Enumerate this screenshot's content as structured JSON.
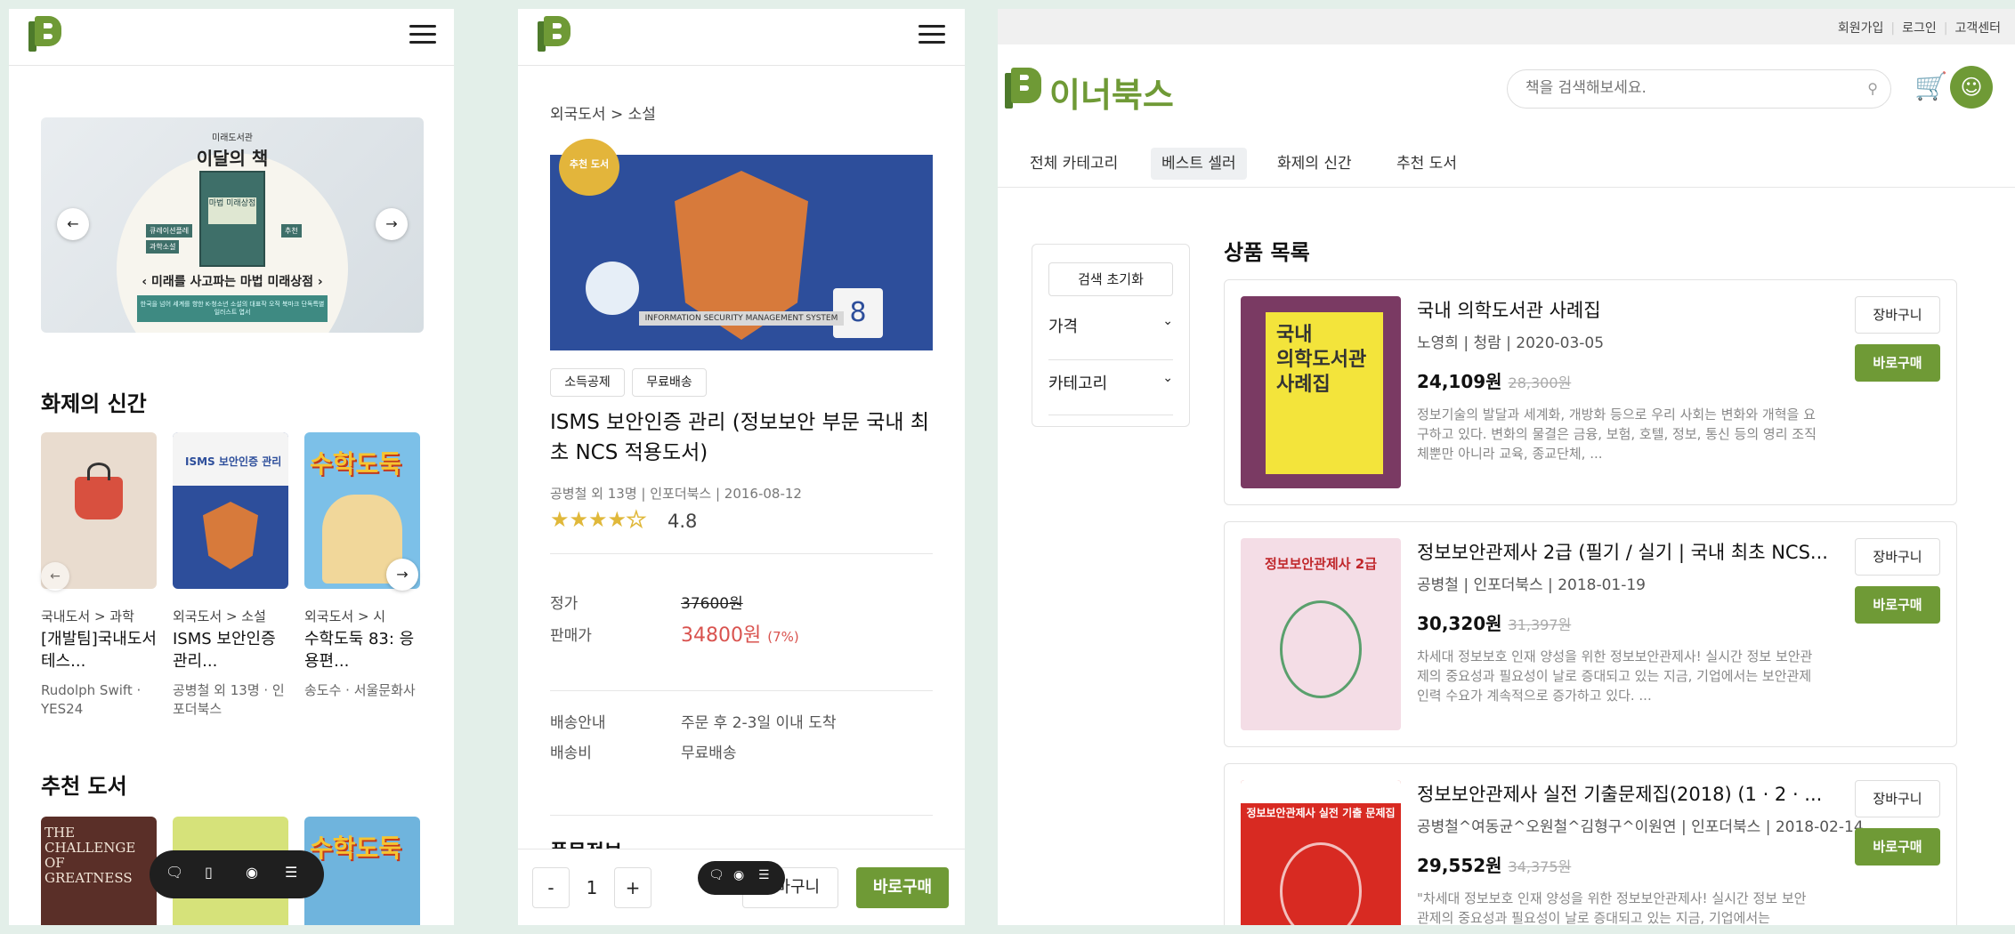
{
  "left_panel": {
    "banner": {
      "kicker": "미래도서관",
      "title": "이달의 책",
      "book_title": "마법 미래상점",
      "tagline": "미래를 사고파는 마법 미래상점",
      "tag1": "큐레이션플레",
      "tag2": "과학소설",
      "tag3": "추천",
      "footer": "한국을 넘어 세계를 향한 K-청소년 소설의 대표작 오직 북마크 단독특별 일러스트 엽서"
    },
    "new_section_title": "화제의 신간",
    "new_books": [
      {
        "category": "국내도서 > 과학",
        "title_l1": "[개발팀]국내도서",
        "title_l2": "테스...",
        "author_l1": "Rudolph Swift ·",
        "author_l2": "YES24"
      },
      {
        "category": "외국도서 > 소설",
        "title_l1": "ISMS 보안인증",
        "title_l2": "관리...",
        "author_l1": "공병철 외 13명 · 인",
        "author_l2": "포더북스"
      },
      {
        "category": "외국도서 > 시",
        "title_l1": "수학도둑 83: 응",
        "title_l2": "용편...",
        "author_l1": "송도수 · 서울문화사",
        "author_l2": ""
      }
    ],
    "recommended_title": "추천 도서",
    "rec_cover1_text": "THE CHALLENGE OF GREATNESS"
  },
  "middle_panel": {
    "breadcrumb": "외국도서  >  소설",
    "cover_caption": "INFORMATION SECURITY MANAGEMENT SYSTEM",
    "badge": "추천 도서",
    "chips": [
      "소득공제",
      "무료배송"
    ],
    "title_l1": "ISMS 보안인증 관리 (정보보안 부문 국내 최",
    "title_l2": "초 NCS 적용도서)",
    "meta": "공병철 외 13명 | 인포더북스 | 2016-08-12",
    "rating": "4.8",
    "price_label": "정가",
    "price_value": "37600원",
    "sale_label": "판매가",
    "sale_value": "34800원",
    "sale_pct": "(7%)",
    "ship_label": "배송안내",
    "ship_value": "주문 후 2-3일 이내 도착",
    "fee_label": "배송비",
    "fee_value": "무료배송",
    "product_info": "품목정보",
    "qty": "1",
    "minus": "-",
    "plus": "+",
    "cart": "장바구니",
    "buy": "바로구매"
  },
  "right_panel": {
    "top_links": [
      "회원가입",
      "로그인",
      "고객센터"
    ],
    "brand": "이너북스",
    "search_placeholder": "책을 검색해보세요.",
    "tabs": [
      "전체 카테고리",
      "베스트 셀러",
      "화제의 신간",
      "추천 도서"
    ],
    "filter": {
      "reset": "검색 초기화",
      "price": "가격",
      "category": "카테고리"
    },
    "list_title": "상품 목록",
    "cart_label": "장바구니",
    "buy_label": "바로구매",
    "products": [
      {
        "title": "국내 의학도서관 사례집",
        "meta": "노영희 | 청람 | 2020-03-05",
        "price": "24,109원",
        "orig": "28,300원",
        "desc": "정보기술의 발달과 세계화, 개방화 등으로 우리 사회는 변화와 개혁을 요구하고 있다. 변화의 물결은 금융, 보험, 호텔, 정보, 통신 등의 영리 조직체뿐만 아니라 교육, 종교단체, ...",
        "cover_line1": "국내",
        "cover_line2": "의학도서관",
        "cover_line3": "사례집"
      },
      {
        "title": "정보보안관제사 2급 (필기 / 실기 | 국내 최초 NCS...",
        "meta": "공병철 | 인포더북스 | 2018-01-19",
        "price": "30,320원",
        "orig": "31,397원",
        "desc": "차세대 정보보호 인재 양성을 위한 정보보안관제사! 실시간 정보 보안관제의 중요성과 필요성이 날로 증대되고 있는 지금, 기업에서는 보안관제 인력 수요가 계속적으로 증가하고 있다. ...",
        "cover_line1": "정보보안관제사 2급",
        "cover_line2": "",
        "cover_line3": ""
      },
      {
        "title": "정보보안관제사 실전 기출문제집(2018) (1 · 2 · ...",
        "meta": "공병철^여동균^오원철^김형구^이원연 | 인포더북스 | 2018-02-14",
        "price": "29,552원",
        "orig": "34,375원",
        "desc": "\"차세대 정보보호 인재 양성을 위한 정보보안관제사! 실시간 정보 보안관제의 중요성과 필요성이 날로 증대되고 있는 지금, 기업에서는",
        "cover_line1": "정보보안관제사 실전 기출 문제집",
        "cover_line2": "",
        "cover_line3": ""
      }
    ]
  },
  "colors": {
    "brand_green": "#6f9a36",
    "dark_green": "#4d7a2b",
    "sale_red": "#d9534f",
    "background": "#e3efe9"
  }
}
